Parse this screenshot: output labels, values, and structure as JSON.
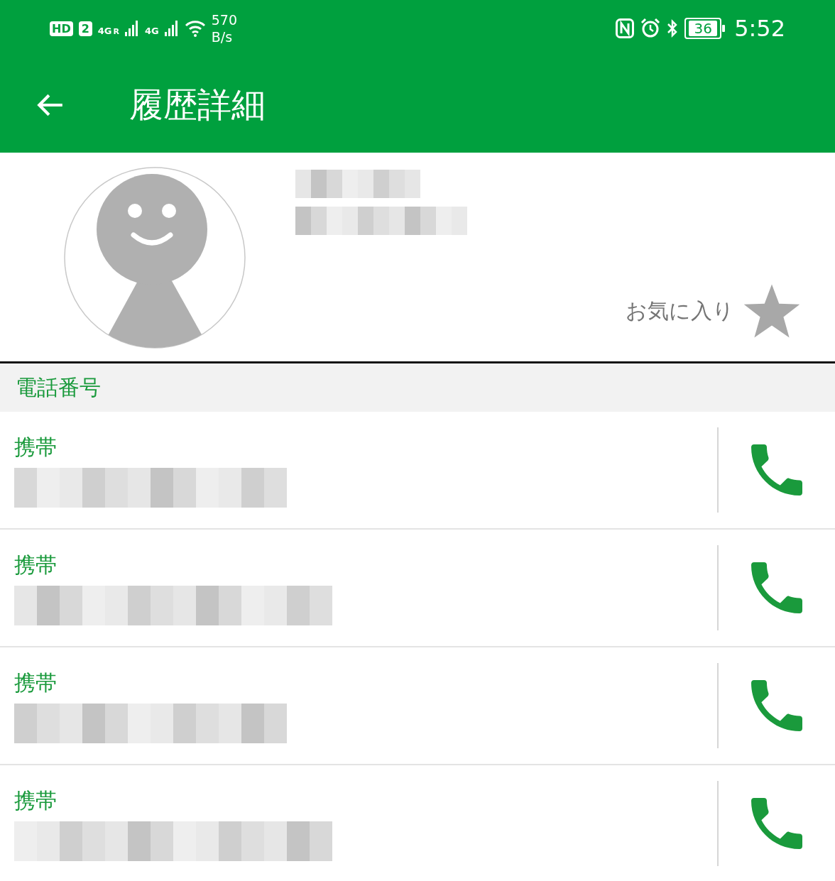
{
  "status_bar": {
    "hd": "HD",
    "sim": "2",
    "net1": "4G",
    "net1_sub": "R",
    "net2": "4G",
    "speed_value": "570",
    "speed_unit": "B/s",
    "battery": "36",
    "time": "5:52"
  },
  "toolbar": {
    "title": "履歴詳細"
  },
  "contact": {
    "name_redacted": true,
    "favorite_label": "お気に入り",
    "favorite": false
  },
  "section": {
    "title": "電話番号"
  },
  "phones": [
    {
      "label": "携帯",
      "number_redacted": true
    },
    {
      "label": "携帯",
      "number_redacted": true
    },
    {
      "label": "携帯",
      "number_redacted": true
    },
    {
      "label": "携帯",
      "number_redacted": true
    }
  ]
}
